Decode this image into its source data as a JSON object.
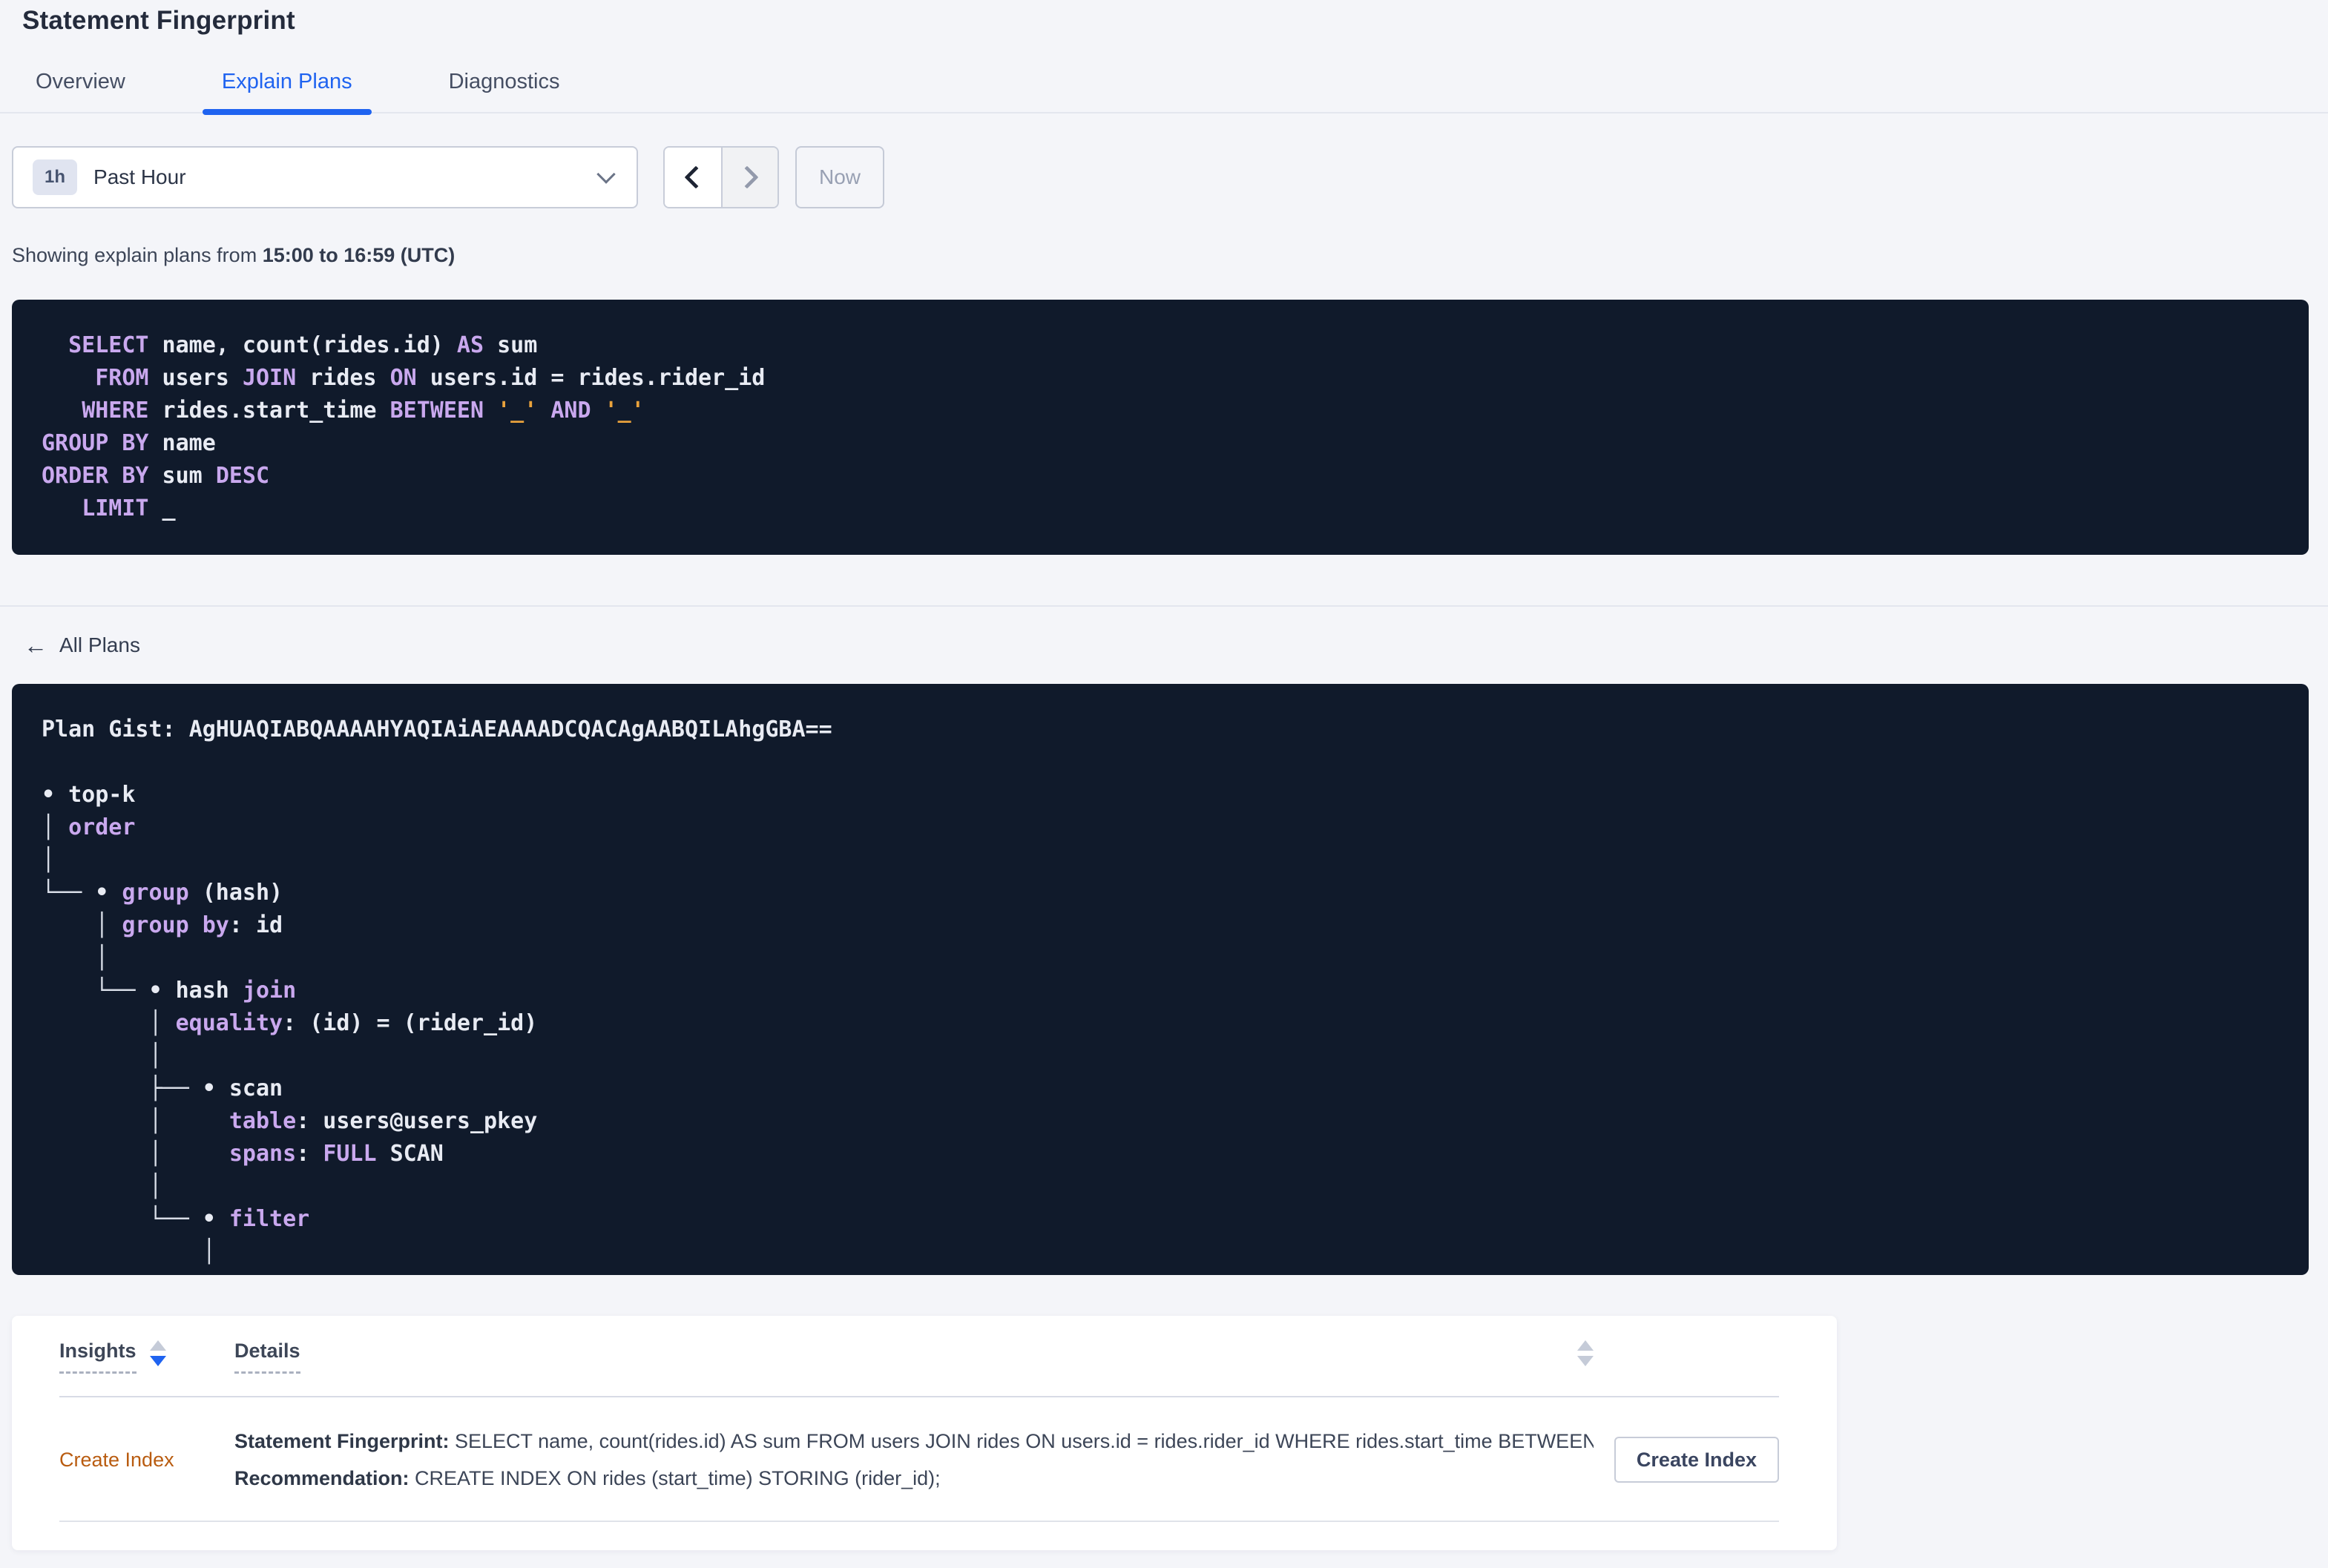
{
  "colors": {
    "accent_blue": "#1f63f0",
    "link_orange": "#b95c10",
    "panel_navy": "#101a2b",
    "syntax_keyword": "#c9a8ee",
    "syntax_plain": "#e8ebf3",
    "syntax_literal": "#e9a23c"
  },
  "header": {
    "title": "Statement Fingerprint"
  },
  "tabs": [
    {
      "label": "Overview"
    },
    {
      "label": "Explain Plans"
    },
    {
      "label": "Diagnostics"
    }
  ],
  "time_picker": {
    "badge": "1h",
    "selected": "Past Hour",
    "now_label": "Now"
  },
  "status": {
    "prefix": "Showing explain plans from ",
    "range": "15:00 to 16:59 (UTC)"
  },
  "sql_lines": [
    [
      {
        "t": "  ",
        "s": "p"
      },
      {
        "t": "SELECT",
        "s": "k"
      },
      {
        "t": " name, count(rides.id) ",
        "s": "p"
      },
      {
        "t": "AS",
        "s": "k"
      },
      {
        "t": " sum",
        "s": "p"
      }
    ],
    [
      {
        "t": "    ",
        "s": "p"
      },
      {
        "t": "FROM",
        "s": "k"
      },
      {
        "t": " users ",
        "s": "p"
      },
      {
        "t": "JOIN",
        "s": "k"
      },
      {
        "t": " rides ",
        "s": "p"
      },
      {
        "t": "ON",
        "s": "k"
      },
      {
        "t": " users.id = rides.rider_id",
        "s": "p"
      }
    ],
    [
      {
        "t": "   ",
        "s": "p"
      },
      {
        "t": "WHERE",
        "s": "k"
      },
      {
        "t": " rides.start_time ",
        "s": "p"
      },
      {
        "t": "BETWEEN",
        "s": "k"
      },
      {
        "t": " ",
        "s": "p"
      },
      {
        "t": "'_'",
        "s": "l"
      },
      {
        "t": " ",
        "s": "p"
      },
      {
        "t": "AND",
        "s": "k"
      },
      {
        "t": " ",
        "s": "p"
      },
      {
        "t": "'_'",
        "s": "l"
      }
    ],
    [
      {
        "t": "GROUP BY",
        "s": "k"
      },
      {
        "t": " name",
        "s": "p"
      }
    ],
    [
      {
        "t": "ORDER BY",
        "s": "k"
      },
      {
        "t": " sum ",
        "s": "p"
      },
      {
        "t": "DESC",
        "s": "k"
      }
    ],
    [
      {
        "t": "   ",
        "s": "p"
      },
      {
        "t": "LIMIT",
        "s": "k"
      },
      {
        "t": " _",
        "s": "p"
      }
    ]
  ],
  "plans": {
    "back_label": "All Plans",
    "gist_label": "Plan Gist:",
    "gist": "AgHUAQIABQAAAAHYAQIAiAEAAAADCQACAgAABQILAhgGBA=="
  },
  "plan_lines": [
    [
      {
        "t": "Plan Gist: ",
        "s": "p"
      },
      {
        "t": "AgHUAQIABQAAAAHYAQIAiAEAAAADCQACAgAABQILAhgGBA==",
        "s": "p"
      }
    ],
    [],
    [
      {
        "t": "• top-k",
        "s": "p"
      }
    ],
    [
      {
        "t": "│ ",
        "s": "b"
      },
      {
        "t": "order",
        "s": "k"
      }
    ],
    [
      {
        "t": "│",
        "s": "b"
      }
    ],
    [
      {
        "t": "└── ",
        "s": "b"
      },
      {
        "t": "• ",
        "s": "p"
      },
      {
        "t": "group",
        "s": "k"
      },
      {
        "t": " (hash)",
        "s": "p"
      }
    ],
    [
      {
        "t": "    ",
        "s": "p"
      },
      {
        "t": "│ ",
        "s": "b"
      },
      {
        "t": "group by",
        "s": "k"
      },
      {
        "t": ": id",
        "s": "p"
      }
    ],
    [
      {
        "t": "    │",
        "s": "b"
      }
    ],
    [
      {
        "t": "    └── ",
        "s": "b"
      },
      {
        "t": "• hash ",
        "s": "p"
      },
      {
        "t": "join",
        "s": "k"
      }
    ],
    [
      {
        "t": "        ",
        "s": "p"
      },
      {
        "t": "│ ",
        "s": "b"
      },
      {
        "t": "equality",
        "s": "k"
      },
      {
        "t": ": (id) = (rider_id)",
        "s": "p"
      }
    ],
    [
      {
        "t": "        │",
        "s": "b"
      }
    ],
    [
      {
        "t": "        ├── ",
        "s": "b"
      },
      {
        "t": "• scan",
        "s": "p"
      }
    ],
    [
      {
        "t": "        │",
        "s": "b"
      },
      {
        "t": "     ",
        "s": "p"
      },
      {
        "t": "table",
        "s": "k"
      },
      {
        "t": ": users@users_pkey",
        "s": "p"
      }
    ],
    [
      {
        "t": "        │",
        "s": "b"
      },
      {
        "t": "     ",
        "s": "p"
      },
      {
        "t": "spans",
        "s": "k"
      },
      {
        "t": ": ",
        "s": "p"
      },
      {
        "t": "FULL",
        "s": "k"
      },
      {
        "t": " SCAN",
        "s": "p"
      }
    ],
    [
      {
        "t": "        │",
        "s": "b"
      }
    ],
    [
      {
        "t": "        └── ",
        "s": "b"
      },
      {
        "t": "• ",
        "s": "p"
      },
      {
        "t": "filter",
        "s": "k"
      }
    ],
    [
      {
        "t": "            │",
        "s": "b"
      }
    ]
  ],
  "insights": {
    "columns": [
      {
        "label": "Insights"
      },
      {
        "label": "Details"
      }
    ],
    "row": {
      "insight": "Create Index",
      "fingerprint_label": "Statement Fingerprint:",
      "fingerprint": " SELECT name, count(rides.id) AS sum FROM users JOIN rides ON users.id = rides.rider_id WHERE rides.start_time BETWEEN '_…",
      "recommendation_label": "Recommendation:",
      "recommendation": " CREATE INDEX ON rides (start_time) STORING (rider_id);",
      "action_label": "Create Index"
    }
  }
}
